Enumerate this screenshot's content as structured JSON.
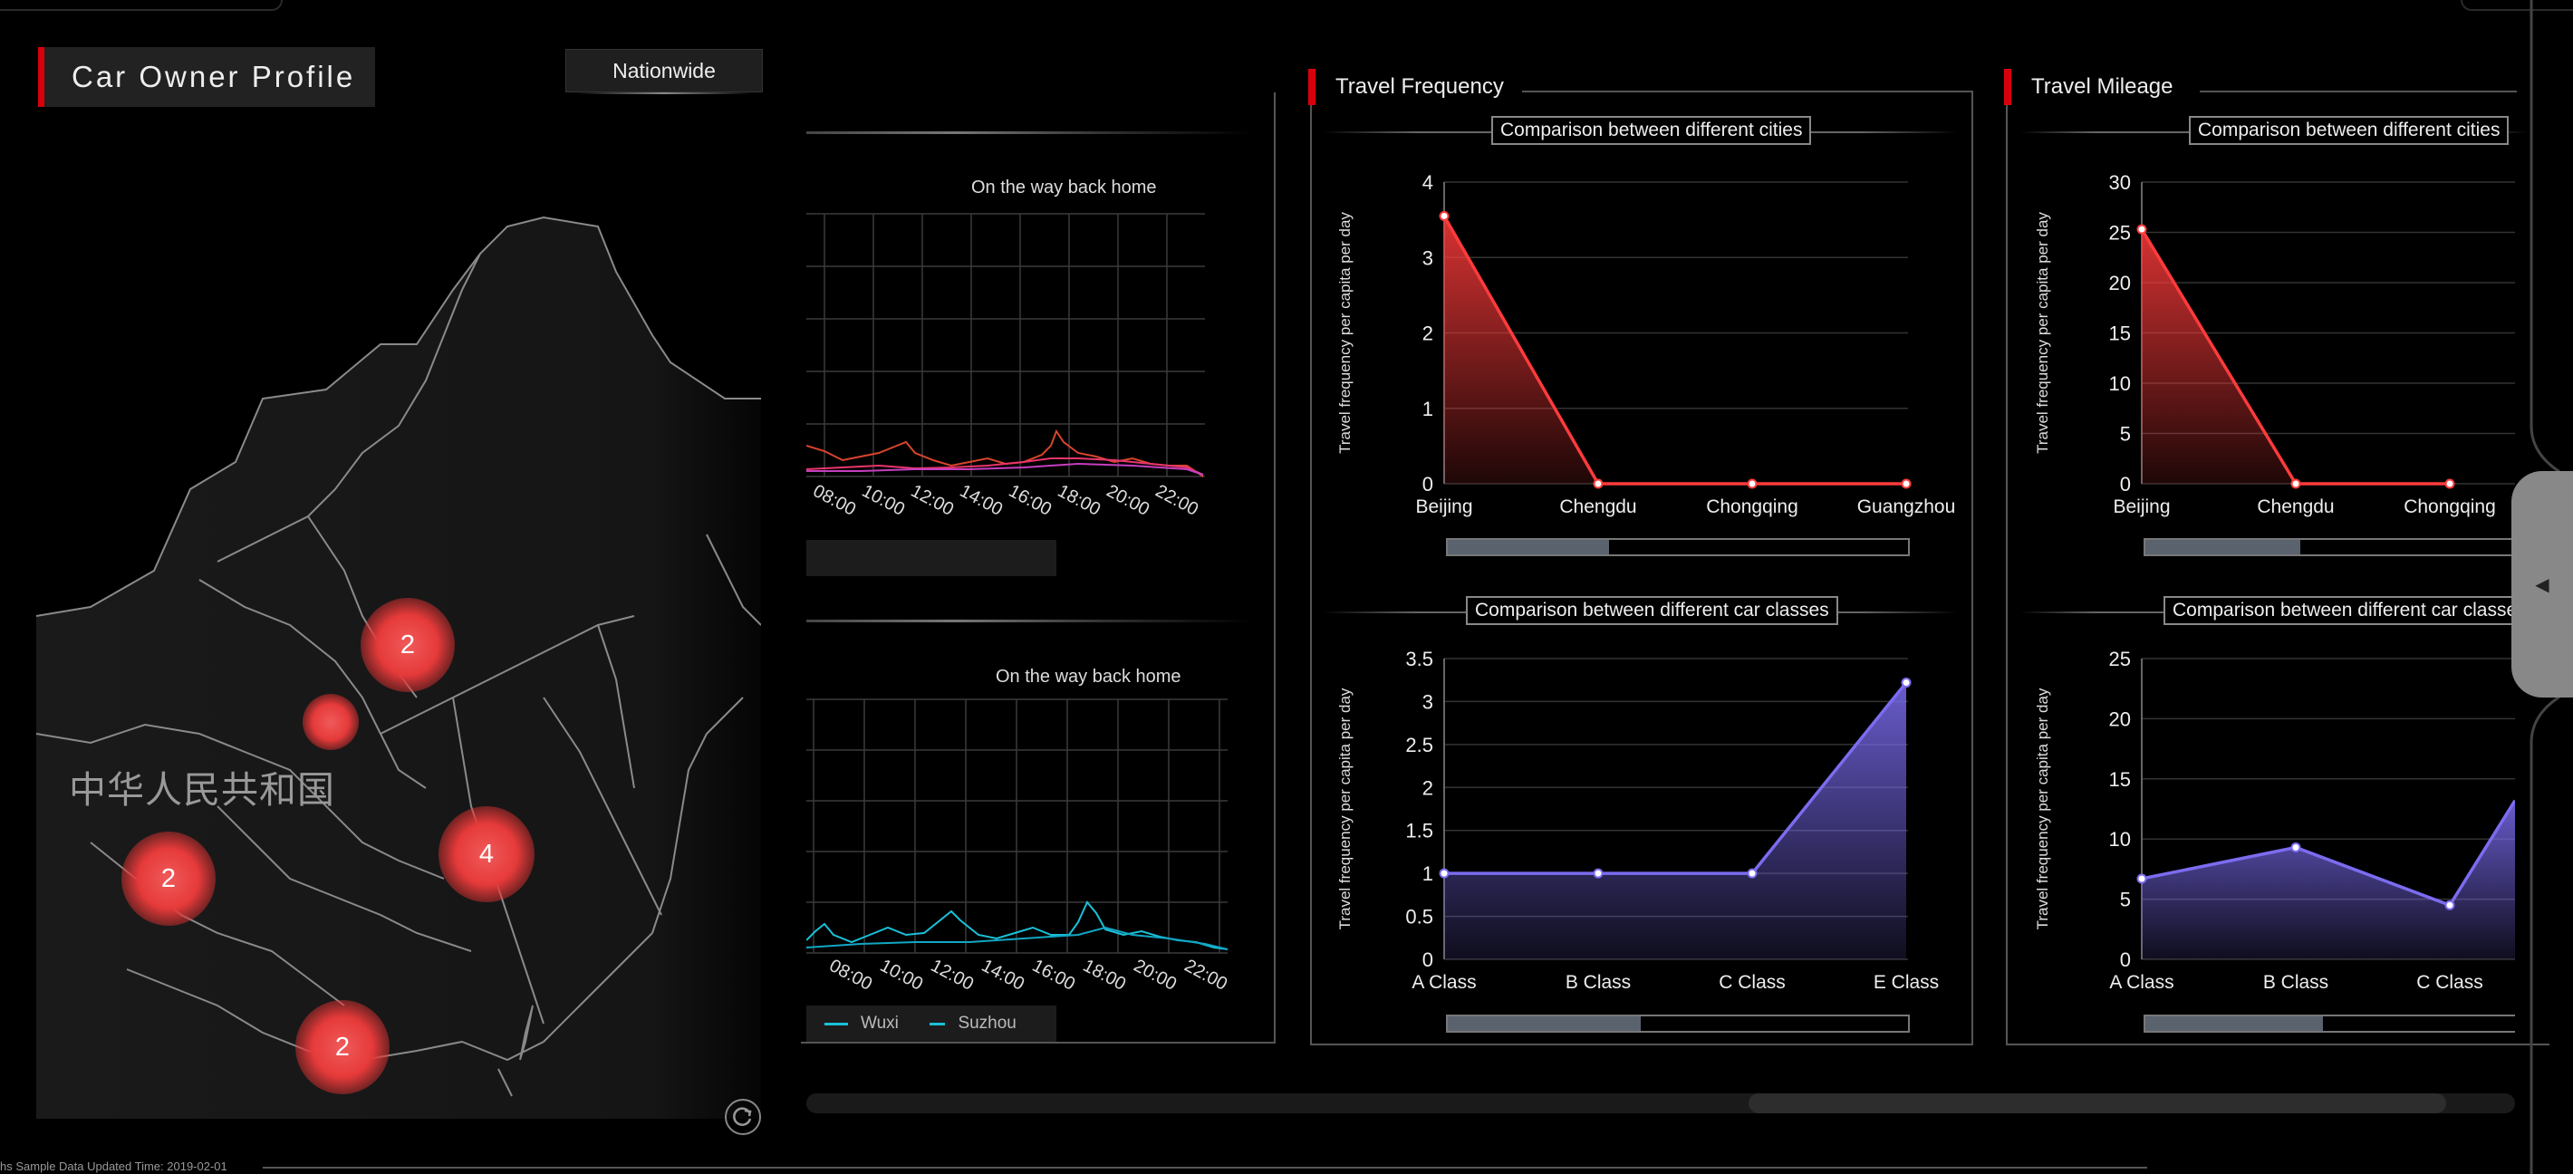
{
  "header": {
    "title": "Car Owner Profile",
    "region_button": "Nationwide"
  },
  "map": {
    "country_label": "中华人民共和国",
    "clusters": [
      {
        "label": "2"
      },
      {
        "label": ""
      },
      {
        "label": "4"
      },
      {
        "label": "2"
      },
      {
        "label": "2"
      }
    ],
    "refresh_icon": "refresh-icon"
  },
  "left_panel": {
    "top_chart": {
      "subtitle": "On the way back home",
      "x_ticks": [
        "08:00",
        "10:00",
        "12:00",
        "14:00",
        "16:00",
        "18:00",
        "20:00",
        "22:00"
      ],
      "colors": {
        "series_a": "#e8356b",
        "series_b": "#c43fbe",
        "series_c": "#d8452c"
      }
    },
    "bottom_chart": {
      "subtitle": "On the way back home",
      "x_ticks": [
        "08:00",
        "10:00",
        "12:00",
        "14:00",
        "16:00",
        "18:00",
        "20:00",
        "22:00"
      ],
      "legend": [
        {
          "name": "Wuxi",
          "color": "#19c1d8"
        },
        {
          "name": "Suzhou",
          "color": "#19c1d8"
        }
      ]
    }
  },
  "frequency_panel": {
    "title": "Travel Frequency",
    "chart_data": [
      {
        "type": "area",
        "subtitle": "Comparison between different cities",
        "ylabel": "Travel frequency per capita per day",
        "categories": [
          "Beijing",
          "Chengdu",
          "Chongqing",
          "Guangzhou"
        ],
        "values": [
          3.55,
          0,
          0,
          0
        ],
        "ylim": [
          0,
          4
        ],
        "y_ticks": [
          "0",
          "1",
          "2",
          "3",
          "4"
        ],
        "color": "#ff3b3b"
      },
      {
        "type": "area",
        "subtitle": "Comparison between different car classes",
        "ylabel": "Travel frequency per capita per day",
        "categories": [
          "A Class",
          "B Class",
          "C Class",
          "E Class"
        ],
        "values": [
          1,
          1,
          1,
          3.22
        ],
        "ylim": [
          0,
          3.5
        ],
        "y_ticks": [
          "0",
          "0.5",
          "1",
          "1.5",
          "2",
          "2.5",
          "3",
          "3.5"
        ],
        "color": "#7b6cf0"
      }
    ]
  },
  "mileage_panel": {
    "title": "Travel Mileage",
    "chart_data": [
      {
        "type": "area",
        "subtitle": "Comparison between different cities",
        "ylabel": "Travel frequency per capita per day",
        "categories": [
          "Beijing",
          "Chengdu",
          "Chongqing"
        ],
        "values": [
          25.3,
          0,
          0
        ],
        "ylim": [
          0,
          30
        ],
        "y_ticks": [
          "0",
          "5",
          "10",
          "15",
          "20",
          "25",
          "30"
        ],
        "color": "#ff3b3b"
      },
      {
        "type": "area",
        "subtitle": "Comparison between different car classes",
        "ylabel": "Travel frequency per capita per day",
        "categories": [
          "A Class",
          "B Class",
          "C Class"
        ],
        "values": [
          6.7,
          9.3,
          4.5
        ],
        "ylim": [
          0,
          25
        ],
        "y_ticks": [
          "0",
          "5",
          "10",
          "15",
          "20",
          "25"
        ],
        "color": "#7b6cf0"
      }
    ]
  },
  "footer": {
    "text": "hs Sample Data    Updated Time: 2019-02-01"
  }
}
